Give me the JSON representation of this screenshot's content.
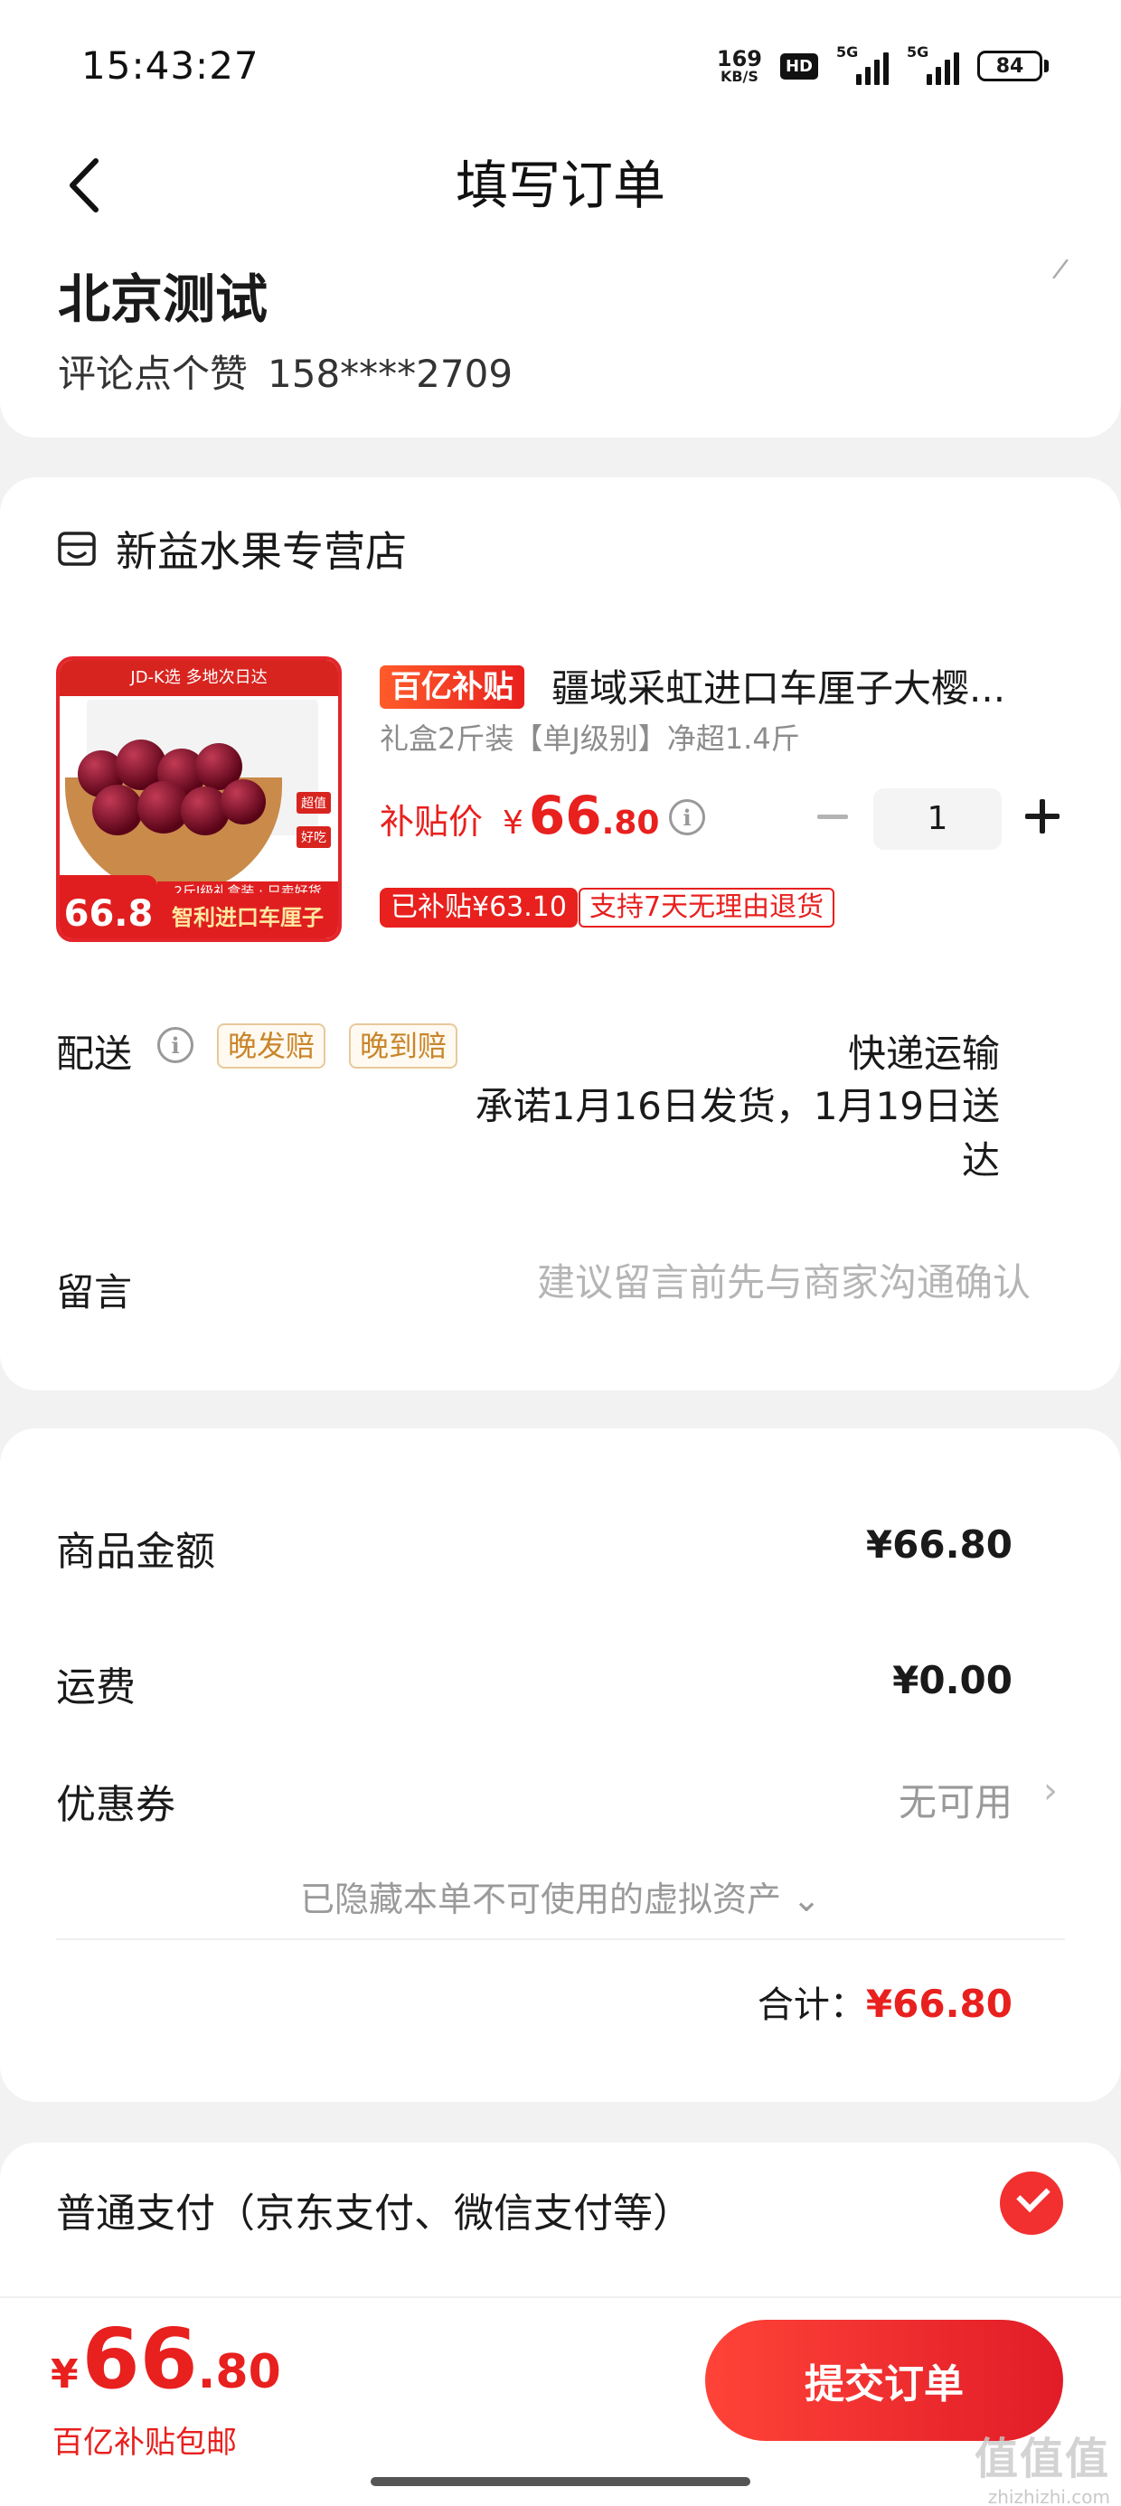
{
  "status_bar": {
    "time": "15:43:27",
    "net_speed_value": "169",
    "net_speed_unit": "KB/S",
    "hd_label": "HD",
    "signal1_label": "5G",
    "signal2_label": "5G",
    "battery": "84"
  },
  "header": {
    "title": "填写订单",
    "back_icon": "chevron-left-icon"
  },
  "address": {
    "name": "北京测试",
    "recipient": "评论点个赞",
    "phone": "158****2709"
  },
  "store": {
    "icon": "store-icon",
    "name": "新益水果专营店"
  },
  "product": {
    "image": {
      "banner": "JD-K选  多地次日达",
      "tag_1": "超值",
      "tag_2": "好吃",
      "small_line": "2斤J级礼盒装 · 只卖好货",
      "price_tag": "66.8",
      "bottom_title": "智利进口车厘子"
    },
    "subsidy_badge": "百亿补贴",
    "title": "疆域采虹进口车厘子大樱...",
    "spec": "礼盒2斤装【单J级别】净超1.4斤",
    "price_label": "补贴价",
    "price_currency": "¥",
    "price_int": "66",
    "price_dec": ".80",
    "quantity": "1",
    "tag_subsidized": "已补贴¥63.10",
    "tag_return": "支持7天无理由退货"
  },
  "delivery": {
    "label": "配送",
    "tag_late": "晚发赔",
    "tag_arrive": "晚到赔",
    "method": "快递运输",
    "promise": "承诺1月16日发货，1月19日送达"
  },
  "note": {
    "label": "留言",
    "placeholder": "建议留言前先与商家沟通确认",
    "value": ""
  },
  "summary": {
    "goods_label": "商品金额",
    "goods_value": "¥66.80",
    "shipping_label": "运费",
    "shipping_value": "¥0.00",
    "coupon_label": "优惠券",
    "coupon_value": "无可用",
    "hidden_assets": "已隐藏本单不可使用的虚拟资产 ⌄",
    "total_label": "合计：",
    "total_value": "¥66.80"
  },
  "payment": {
    "label": "普通支付（京东支付、微信支付等）",
    "selected": true
  },
  "bottom": {
    "currency": "¥",
    "price_int": "66",
    "price_dec": ".80",
    "note": "百亿补贴包邮",
    "submit_label": "提交订单"
  },
  "watermark": {
    "main": "值值值",
    "sub": "zhizhizhi.com"
  },
  "colors": {
    "accent": "#e8201e",
    "background": "#f2f2f2",
    "tag_border": "#e8c99a"
  }
}
